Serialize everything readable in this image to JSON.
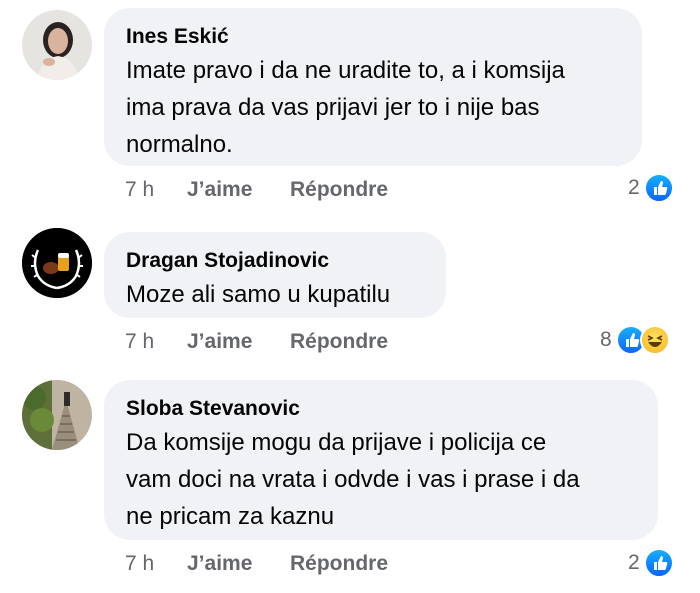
{
  "comments": [
    {
      "author": "Ines Eskić",
      "text": "Imate pravo i da ne uradite to, a i komsija\nima prava da vas prijavi jer to i nije bas\nnormalno.",
      "time": "7 h",
      "like_label": "J’aime",
      "reply_label": "Répondre",
      "reaction_count": "2",
      "reactions": [
        "like-icon"
      ]
    },
    {
      "author": "Dragan Stojadinovic",
      "text": "Moze ali samo u kupatilu",
      "time": "7 h",
      "like_label": "J’aime",
      "reply_label": "Répondre",
      "reaction_count": "8",
      "reactions": [
        "like-icon",
        "haha-icon"
      ]
    },
    {
      "author": "Sloba Stevanovic",
      "text": "Da komsije mogu da prijave i policija ce\nvam doci na vrata i odvde i vas i prase i da\nne pricam za kaznu",
      "time": "7 h",
      "like_label": "J’aime",
      "reply_label": "Répondre",
      "reaction_count": "2",
      "reactions": [
        "like-icon"
      ]
    }
  ],
  "colors": {
    "bubble": "#f0f2f5",
    "meta": "#65676b",
    "like_blue": "#0866ff",
    "haha_yellow": "#f7b125"
  }
}
